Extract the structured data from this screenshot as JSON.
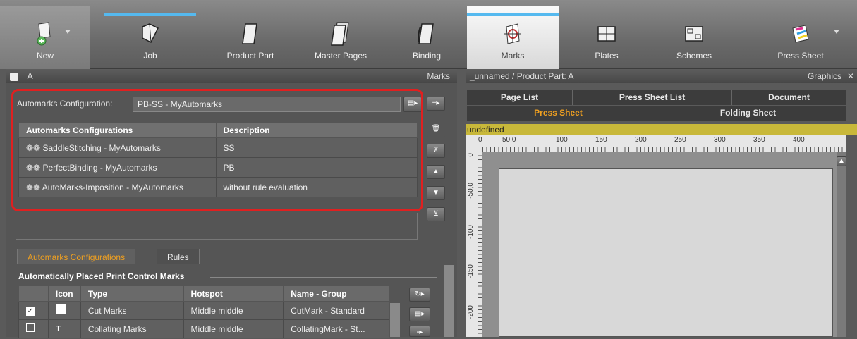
{
  "toolbar": {
    "new": "New",
    "job": "Job",
    "product_part": "Product Part",
    "master_pages": "Master Pages",
    "binding": "Binding",
    "marks": "Marks",
    "plates": "Plates",
    "schemes": "Schemes",
    "press_sheet": "Press Sheet"
  },
  "left_panel": {
    "header_left": "A",
    "header_right": "Marks",
    "config_label": "Automarks Configuration:",
    "config_value": "PB-SS - MyAutomarks",
    "table": {
      "headers": [
        "Automarks Configurations",
        "Description"
      ],
      "rows": [
        {
          "name": "SaddleStitching - MyAutomarks",
          "desc": "SS"
        },
        {
          "name": "PerfectBinding - MyAutomarks",
          "desc": "PB"
        },
        {
          "name": "AutoMarks-Imposition - MyAutomarks",
          "desc": "without rule evaluation"
        }
      ]
    },
    "tabs": [
      "Automarks Configurations",
      "Rules"
    ],
    "section_title": "Automatically Placed Print Control Marks",
    "lower_table": {
      "headers": [
        "Icon",
        "Type",
        "Hotspot",
        "Name - Group"
      ],
      "rows": [
        {
          "type": "Cut Marks",
          "hotspot": "Middle middle",
          "name": "CutMark - Standard",
          "checked": true,
          "icon": "cut-mark-icon"
        },
        {
          "type": "Collating Marks",
          "hotspot": "Middle middle",
          "name": "CollatingMark - St...",
          "checked": false,
          "icon": "text-icon"
        }
      ]
    }
  },
  "right_panel": {
    "header_left": "_unnamed / Product Part: A",
    "header_right": "Graphics",
    "tabs_row1": [
      "Page List",
      "Press Sheet List",
      "Document"
    ],
    "tabs_row2": [
      "Press Sheet",
      "Folding Sheet"
    ],
    "status": "undefined",
    "ruler_h": [
      "0",
      "50,0",
      "100",
      "150",
      "200",
      "250",
      "300",
      "350",
      "400"
    ],
    "ruler_v": [
      "0",
      "-50,0",
      "-100",
      "-150",
      "-200"
    ]
  },
  "colors": {
    "accent": "#55b9ef",
    "active_tab": "#f0a020",
    "highlight": "#e02020",
    "status_bar": "#c8b83a"
  }
}
